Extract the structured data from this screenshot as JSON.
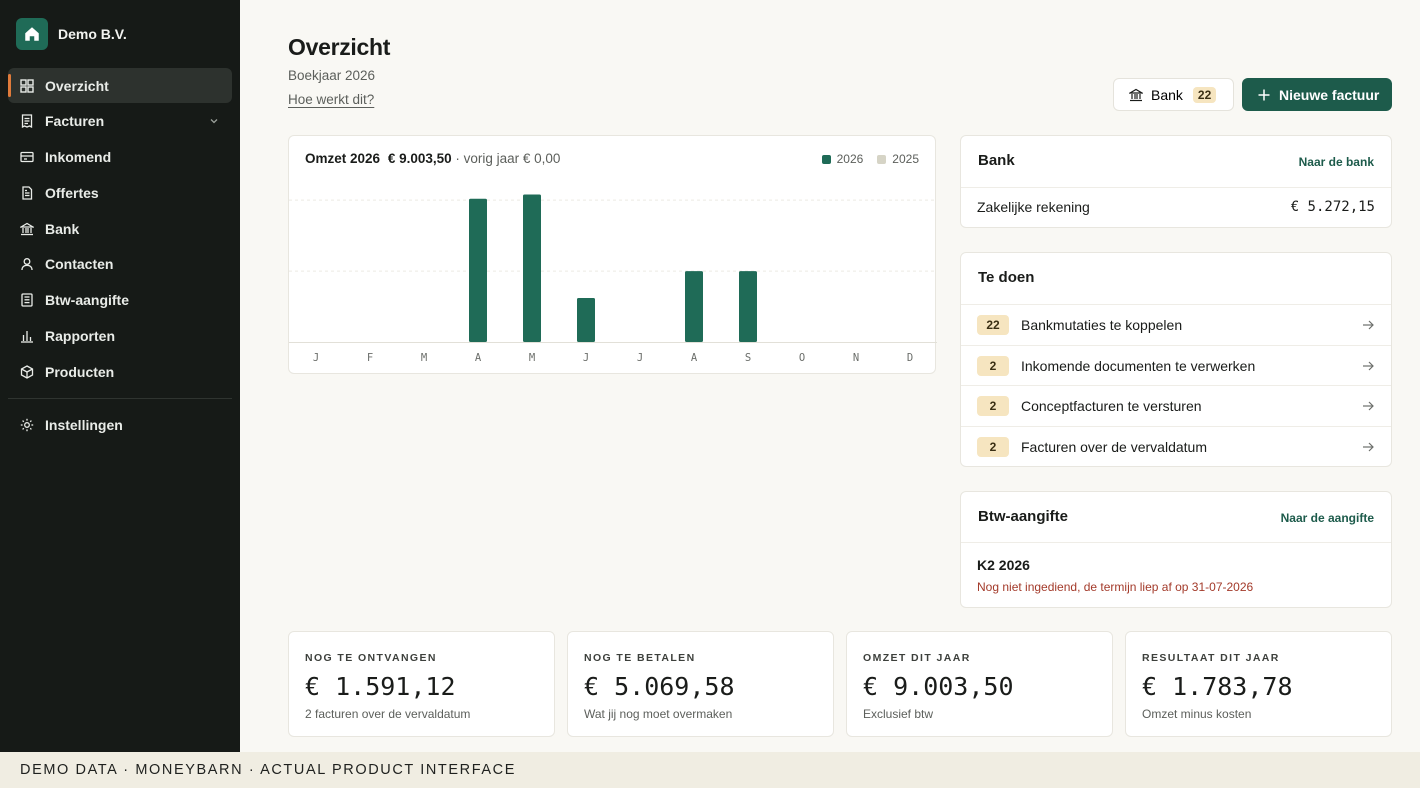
{
  "sidebar": {
    "org_name": "Demo B.V.",
    "items": [
      {
        "label": "Overzicht",
        "icon": "dashboard-icon"
      },
      {
        "label": "Facturen",
        "icon": "invoice-icon"
      },
      {
        "label": "Inkomend",
        "icon": "inbox-icon"
      },
      {
        "label": "Offertes",
        "icon": "quote-icon"
      },
      {
        "label": "Bank",
        "icon": "bank-icon"
      },
      {
        "label": "Contacten",
        "icon": "user-icon"
      },
      {
        "label": "Btw-aangifte",
        "icon": "tax-icon"
      },
      {
        "label": "Rapporten",
        "icon": "bar-chart-icon"
      },
      {
        "label": "Producten",
        "icon": "box-icon"
      }
    ],
    "settings_label": "Instellingen"
  },
  "header": {
    "title": "Overzicht",
    "subtitle": "Boekjaar 2026",
    "help_link": "Hoe werkt dit?",
    "bank_button": "Bank",
    "bank_count": "22",
    "new_invoice_button": "Nieuwe factuur"
  },
  "revenue": {
    "label": "Omzet 2026",
    "amount": "€ 9.003,50",
    "previous": "· vorig jaar € 0,00"
  },
  "chart_data": {
    "type": "bar",
    "categories": [
      "J",
      "F",
      "M",
      "A",
      "M",
      "J",
      "J",
      "A",
      "S",
      "O",
      "N",
      "D"
    ],
    "series": [
      {
        "name": "2026",
        "values": [
          0,
          0,
          0,
          2020,
          2080,
          620,
          0,
          1000,
          1000,
          0,
          0,
          0
        ],
        "color": "#1f6b57"
      },
      {
        "name": "2025",
        "values": [
          0,
          0,
          0,
          0,
          0,
          0,
          0,
          0,
          0,
          0,
          0,
          0
        ],
        "color": "#d6d4c6"
      }
    ],
    "ylim": [
      0,
      2200
    ],
    "grid": true,
    "legend": "top-right"
  },
  "bank_card": {
    "title": "Bank",
    "link": "Naar de bank",
    "account": "Zakelijke rekening",
    "balance": "€ 5.272,15"
  },
  "todo": {
    "title": "Te doen",
    "items": [
      {
        "count": "22",
        "label": "Bankmutaties te koppelen"
      },
      {
        "count": "2",
        "label": "Inkomende documenten te verwerken"
      },
      {
        "count": "2",
        "label": "Conceptfacturen te versturen"
      },
      {
        "count": "2",
        "label": "Facturen over de vervaldatum"
      }
    ]
  },
  "vat": {
    "title": "Btw-aangifte",
    "link": "Naar de aangifte",
    "period": "K2 2026",
    "note": "Nog niet ingediend, de termijn liep af op 31-07-2026"
  },
  "kpis": [
    {
      "label": "NOG TE ONTVANGEN",
      "value": "€ 1.591,12",
      "sub": "2 facturen over de vervaldatum"
    },
    {
      "label": "NOG TE BETALEN",
      "value": "€ 5.069,58",
      "sub": "Wat jij nog moet overmaken"
    },
    {
      "label": "OMZET DIT JAAR",
      "value": "€ 9.003,50",
      "sub": "Exclusief btw"
    },
    {
      "label": "RESULTAAT DIT JAAR",
      "value": "€ 1.783,78",
      "sub": "Omzet minus kosten"
    }
  ],
  "footer": "DEMO DATA · MONEYBARN · ACTUAL PRODUCT INTERFACE"
}
